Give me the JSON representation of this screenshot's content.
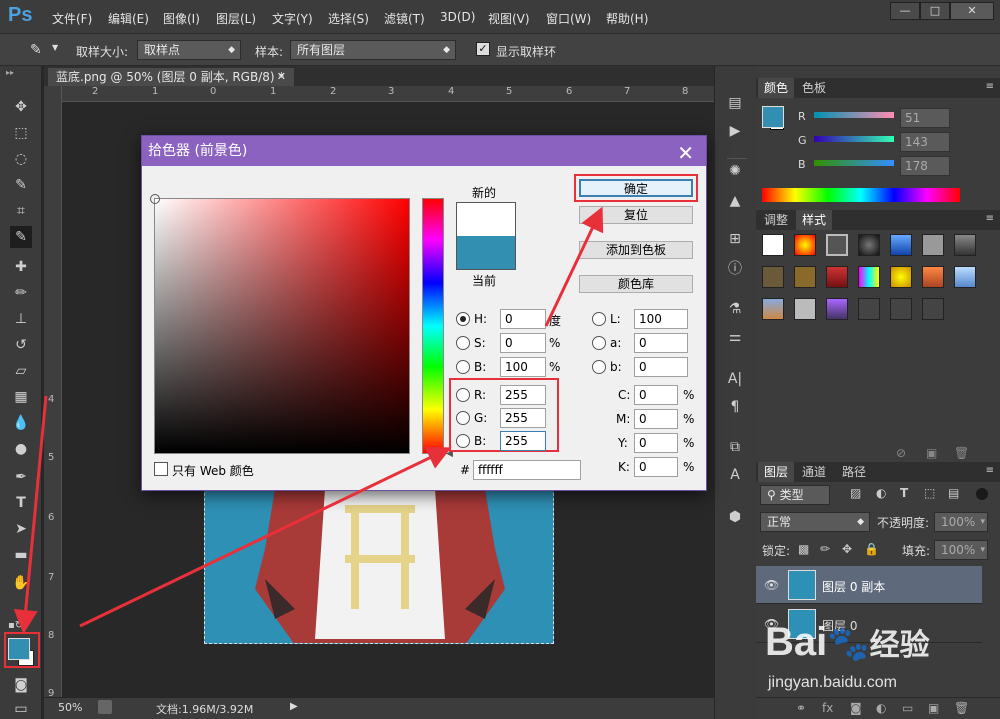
{
  "app": {
    "logo": "Ps",
    "menu": [
      "文件(F)",
      "编辑(E)",
      "图像(I)",
      "图层(L)",
      "文字(Y)",
      "选择(S)",
      "滤镜(T)",
      "3D(D)",
      "视图(V)",
      "窗口(W)",
      "帮助(H)"
    ],
    "window_controls": [
      "—",
      "□",
      "✕"
    ]
  },
  "options_bar": {
    "sample_size_label": "取样大小:",
    "sample_size_value": "取样点",
    "sample_label": "样本:",
    "sample_value": "所有图层",
    "show_ring_label": "显示取样环",
    "show_ring_checked": true
  },
  "document": {
    "tab_title": "蓝底.png @ 50% (图层 0 副本, RGB/8) *",
    "ruler_top": [
      "2",
      "1",
      "0",
      "1",
      "2",
      "3",
      "4",
      "5",
      "6",
      "7",
      "8"
    ],
    "ruler_left": [
      "4",
      "5",
      "6",
      "7",
      "8",
      "9"
    ],
    "zoom": "50%",
    "doc_info": "文档:1.96M/3.92M"
  },
  "color_panel": {
    "tabs": [
      "颜色",
      "色板"
    ],
    "sliders": [
      {
        "label": "R",
        "value": "51"
      },
      {
        "label": "G",
        "value": "143"
      },
      {
        "label": "B",
        "value": "178"
      }
    ],
    "foreground_color": "#338fb2"
  },
  "styles_panel": {
    "tabs": [
      "调整",
      "样式"
    ]
  },
  "layers_panel": {
    "tabs": [
      "图层",
      "通道",
      "路径"
    ],
    "filter_label": "类型",
    "blend_mode": "正常",
    "opacity_label": "不透明度:",
    "opacity_value": "100%",
    "lock_label": "锁定:",
    "fill_label": "填充:",
    "fill_value": "100%",
    "layers": [
      {
        "name": "图层 0 副本",
        "selected": true
      },
      {
        "name": "图层 0",
        "selected": false
      }
    ]
  },
  "dialog": {
    "title": "拾色器 (前景色)",
    "new_label": "新的",
    "current_label": "当前",
    "new_color": "#ffffff",
    "current_color": "#338fb2",
    "buttons": {
      "ok": "确定",
      "reset": "复位",
      "add_swatch": "添加到色板",
      "color_libraries": "颜色库"
    },
    "hsb": [
      {
        "label": "H:",
        "value": "0",
        "unit": "度",
        "selected": true
      },
      {
        "label": "S:",
        "value": "0",
        "unit": "%",
        "selected": false
      },
      {
        "label": "B:",
        "value": "100",
        "unit": "%",
        "selected": false
      }
    ],
    "rgb": [
      {
        "label": "R:",
        "value": "255"
      },
      {
        "label": "G:",
        "value": "255"
      },
      {
        "label": "B:",
        "value": "255"
      }
    ],
    "lab": [
      {
        "label": "L:",
        "value": "100"
      },
      {
        "label": "a:",
        "value": "0"
      },
      {
        "label": "b:",
        "value": "0"
      }
    ],
    "cmyk": [
      {
        "label": "C:",
        "value": "0",
        "unit": "%"
      },
      {
        "label": "M:",
        "value": "0",
        "unit": "%"
      },
      {
        "label": "Y:",
        "value": "0",
        "unit": "%"
      },
      {
        "label": "K:",
        "value": "0",
        "unit": "%"
      }
    ],
    "hex_label": "#",
    "hex_value": "ffffff",
    "web_only_label": "只有 Web 颜色"
  },
  "watermark": {
    "logo_text": "Bai",
    "logo_text2": "经验",
    "url": "jingyan.baidu.com"
  },
  "accent_red": "#e8303a"
}
